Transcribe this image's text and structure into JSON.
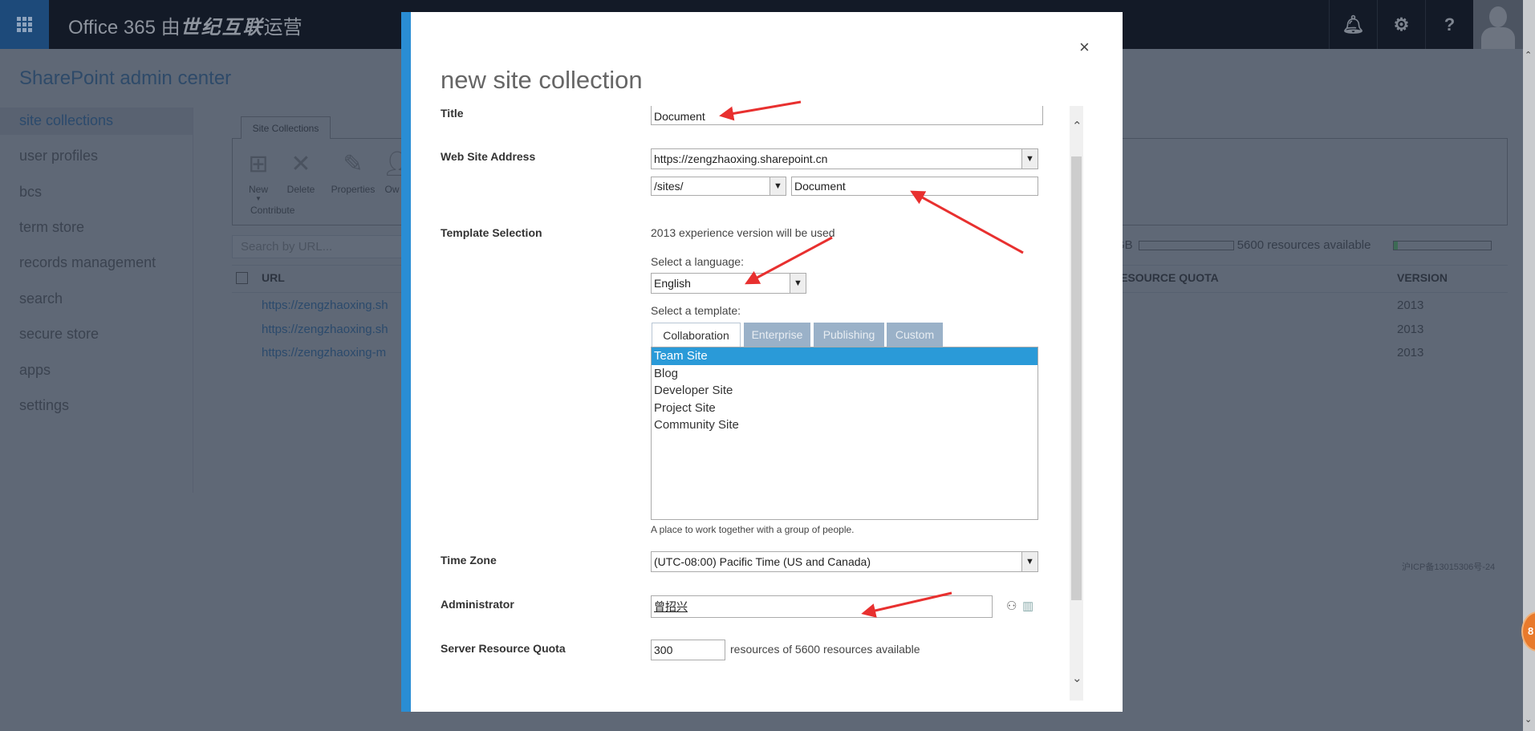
{
  "topbar": {
    "brand_prefix": "Office 365 由",
    "brand_bold": "世纪互联",
    "brand_suffix": "运营",
    "icons": [
      "waffle-icon",
      "bell-icon",
      "gear-icon",
      "help-icon",
      "avatar"
    ]
  },
  "page": {
    "heading": "SharePoint admin center"
  },
  "sidebar": {
    "items": [
      {
        "label": "site collections",
        "selected": true
      },
      {
        "label": "user profiles"
      },
      {
        "label": "bcs"
      },
      {
        "label": "term store"
      },
      {
        "label": "records management"
      },
      {
        "label": "search"
      },
      {
        "label": "secure store"
      },
      {
        "label": "apps"
      },
      {
        "label": "settings"
      }
    ]
  },
  "ribbon": {
    "tab": "Site Collections",
    "buttons": [
      "New",
      "Delete",
      "Properties",
      "Ow"
    ],
    "group": "Contribute"
  },
  "search": {
    "placeholder": "Search by URL..."
  },
  "storage": {
    "unit": "GB",
    "resources": "5600 resources available"
  },
  "table": {
    "headers": {
      "url": "URL",
      "quota": "RESOURCE QUOTA",
      "version": "VERSION"
    },
    "rows": [
      {
        "url": "https://zengzhaoxing.sh",
        "version": "2013"
      },
      {
        "url": "https://zengzhaoxing.sh",
        "version": "2013"
      },
      {
        "url": "https://zengzhaoxing-m",
        "version": "2013"
      }
    ]
  },
  "footer": {
    "icp": "沪ICP备13015306号-24"
  },
  "badge": {
    "text": "8"
  },
  "dialog": {
    "title": "new site collection",
    "close": "×",
    "labels": {
      "title": "Title",
      "address": "Web Site Address",
      "template": "Template Selection",
      "timezone": "Time Zone",
      "admin": "Administrator",
      "quota": "Server Resource Quota"
    },
    "title_value": "Document",
    "domain_value": "https://zengzhaoxing.sharepoint.cn",
    "path_value": "/sites/",
    "url_name_value": "Document",
    "experience_note": "2013 experience version will be used",
    "language_label": "Select a language:",
    "language_value": "English",
    "template_label": "Select a template:",
    "template_tabs": [
      "Collaboration",
      "Enterprise",
      "Publishing",
      "Custom"
    ],
    "templates": [
      "Team Site",
      "Blog",
      "Developer Site",
      "Project Site",
      "Community Site"
    ],
    "selected_template": "Team Site",
    "template_description": "A place to work together with a group of people.",
    "timezone_value": "(UTC-08:00) Pacific Time (US and Canada)",
    "admin_value": "曾招兴",
    "quota_value": "300",
    "quota_note": "resources of 5600 resources available"
  },
  "colors": {
    "accent": "#2a8dd4",
    "selected": "#2a9ad8",
    "annotation_arrow": "#e8302f"
  }
}
